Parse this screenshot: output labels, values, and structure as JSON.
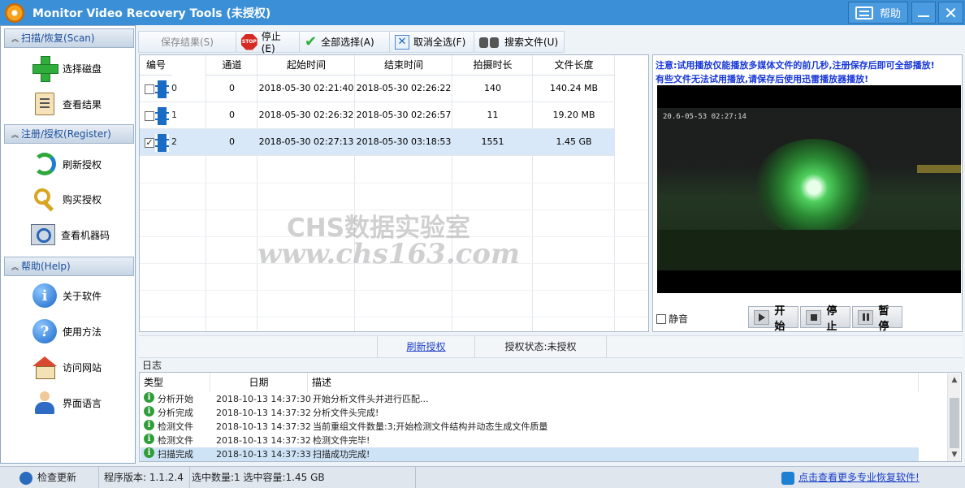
{
  "window": {
    "title": "Monitor Video Recovery Tools (未授权)",
    "help_label": "帮助"
  },
  "sidebar": {
    "sections": [
      {
        "title": "扫描/恢复(Scan)",
        "items": [
          {
            "label": "选择磁盘",
            "icon": "add-icon"
          },
          {
            "label": "查看结果",
            "icon": "clipboard-icon"
          }
        ]
      },
      {
        "title": "注册/授权(Register)",
        "items": [
          {
            "label": "刷新授权",
            "icon": "refresh-icon"
          },
          {
            "label": "购买授权",
            "icon": "key-icon"
          },
          {
            "label": "查看机器码",
            "icon": "scanner-icon"
          }
        ]
      },
      {
        "title": "帮助(Help)",
        "items": [
          {
            "label": "关于软件",
            "icon": "info-icon"
          },
          {
            "label": "使用方法",
            "icon": "question-icon"
          },
          {
            "label": "访问网站",
            "icon": "home-icon"
          },
          {
            "label": "界面语言",
            "icon": "user-icon"
          }
        ]
      }
    ]
  },
  "toolbar": {
    "save": "保存结果(S)",
    "stop": "停止(E)",
    "stop_icon_text": "STOP",
    "select_all": "全部选择(A)",
    "deselect_all": "取消全选(F)",
    "search_files": "搜索文件(U)"
  },
  "file_table": {
    "headers": [
      "编号",
      "通道",
      "起始时间",
      "结束时间",
      "拍摄时长",
      "文件长度"
    ],
    "rows": [
      {
        "id": "0",
        "channel": "0",
        "start": "2018-05-30 02:21:40",
        "end": "2018-05-30 02:26:22",
        "duration": "140",
        "size": "140.24 MB",
        "checked": false,
        "check_mark": ""
      },
      {
        "id": "1",
        "channel": "0",
        "start": "2018-05-30 02:26:32",
        "end": "2018-05-30 02:26:57",
        "duration": "11",
        "size": "19.20 MB",
        "checked": false,
        "check_mark": ""
      },
      {
        "id": "2",
        "channel": "0",
        "start": "2018-05-30 02:27:13",
        "end": "2018-05-30 03:18:53",
        "duration": "1551",
        "size": "1.45 GB",
        "checked": true,
        "check_mark": "✓"
      }
    ]
  },
  "preview": {
    "note1": "注意:试用播放仅能播放多媒体文件的前几秒,注册保存后即可全部播放!",
    "note2": "有些文件无法试用播放,请保存后使用迅雷播放器播放!",
    "osd_timestamp": "20.6-05-53 02:27:14",
    "mute_label": "静音",
    "play_label": "开始",
    "stop_label": "停止",
    "pause_label": "暂停"
  },
  "mid_status": {
    "refresh_link": "刷新授权",
    "license_status": "授权状态:未授权"
  },
  "log": {
    "label": "日志",
    "headers": [
      "类型",
      "日期",
      "描述"
    ],
    "rows": [
      {
        "type": "分析开始",
        "date": "2018-10-13 14:37:30",
        "desc": "开始分析文件头并进行匹配..."
      },
      {
        "type": "分析完成",
        "date": "2018-10-13 14:37:32",
        "desc": "分析文件头完成!"
      },
      {
        "type": "检测文件",
        "date": "2018-10-13 14:37:32",
        "desc": "当前重组文件数量:3;开始检测文件结构并动态生成文件质量"
      },
      {
        "type": "检测文件",
        "date": "2018-10-13 14:37:32",
        "desc": "检测文件完毕!"
      },
      {
        "type": "扫描完成",
        "date": "2018-10-13 14:37:33",
        "desc": "扫描成功完成!"
      }
    ]
  },
  "statusbar": {
    "check_update": "检查更新",
    "version": "程序版本:  1.1.2.4",
    "selection": "选中数量:1 选中容量:1.45 GB",
    "more_link": "点击查看更多专业恢复软件!"
  },
  "watermark": {
    "line1": "CHS数据实验室",
    "line2": "www.chs163.com"
  },
  "colors": {
    "titlebar": "#3a8fd6",
    "note_text": "#1838d8",
    "selected_row": "#d8e8f8",
    "link": "#1a3fc8"
  }
}
